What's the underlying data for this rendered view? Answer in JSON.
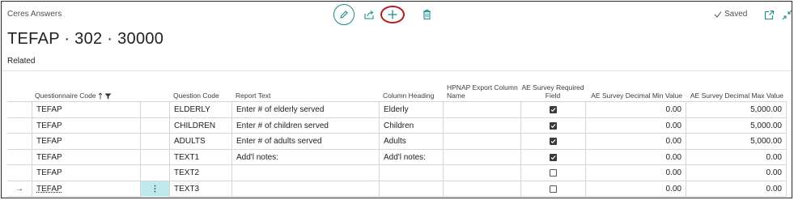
{
  "app": {
    "name": "Ceres Answers",
    "saved_label": "Saved"
  },
  "toolbar": {
    "edit_icon": "pencil-icon",
    "share_icon": "share-icon",
    "new_icon": "plus-icon",
    "delete_icon": "trash-icon",
    "accent": "#1a8d8b",
    "highlight_circle": "#b8161e"
  },
  "page": {
    "title": "TEFAP · 302 · 30000",
    "related_label": "Related"
  },
  "columns": {
    "questionnaire_code": "Questionnaire Code",
    "question_code": "Question Code",
    "report_text": "Report Text",
    "column_heading": "Column Heading",
    "hpnap_export_column_name": "HPNAP Export Column Name",
    "ae_survey_required_field": "AE Survey Required Field",
    "ae_survey_decimal_min_value": "AE Survey Decimal Min Value",
    "ae_survey_decimal_max_value": "AE Survey Decimal Max Value"
  },
  "rows": [
    {
      "questionnaire_code": "TEFAP",
      "question_code": "ELDERLY",
      "report_text": "Enter # of elderly served",
      "column_heading": "Elderly",
      "hpnap": "",
      "required": true,
      "min": "0.00",
      "max": "5,000.00",
      "current": false
    },
    {
      "questionnaire_code": "TEFAP",
      "question_code": "CHILDREN",
      "report_text": "Enter # of children served",
      "column_heading": "Children",
      "hpnap": "",
      "required": true,
      "min": "0.00",
      "max": "5,000.00",
      "current": false
    },
    {
      "questionnaire_code": "TEFAP",
      "question_code": "ADULTS",
      "report_text": "Enter # of adults served",
      "column_heading": "Adults",
      "hpnap": "",
      "required": true,
      "min": "0.00",
      "max": "5,000.00",
      "current": false
    },
    {
      "questionnaire_code": "TEFAP",
      "question_code": "TEXT1",
      "report_text": "Add'l notes:",
      "column_heading": "Add'l notes:",
      "hpnap": "",
      "required": true,
      "min": "0.00",
      "max": "0.00",
      "current": false
    },
    {
      "questionnaire_code": "TEFAP",
      "question_code": "TEXT2",
      "report_text": "",
      "column_heading": "",
      "hpnap": "",
      "required": false,
      "min": "0.00",
      "max": "0.00",
      "current": false
    },
    {
      "questionnaire_code": "TEFAP",
      "question_code": "TEXT3",
      "report_text": "",
      "column_heading": "",
      "hpnap": "",
      "required": false,
      "min": "0.00",
      "max": "0.00",
      "current": true
    }
  ],
  "row_menu_glyph": "⋮",
  "current_row_glyph": "→"
}
